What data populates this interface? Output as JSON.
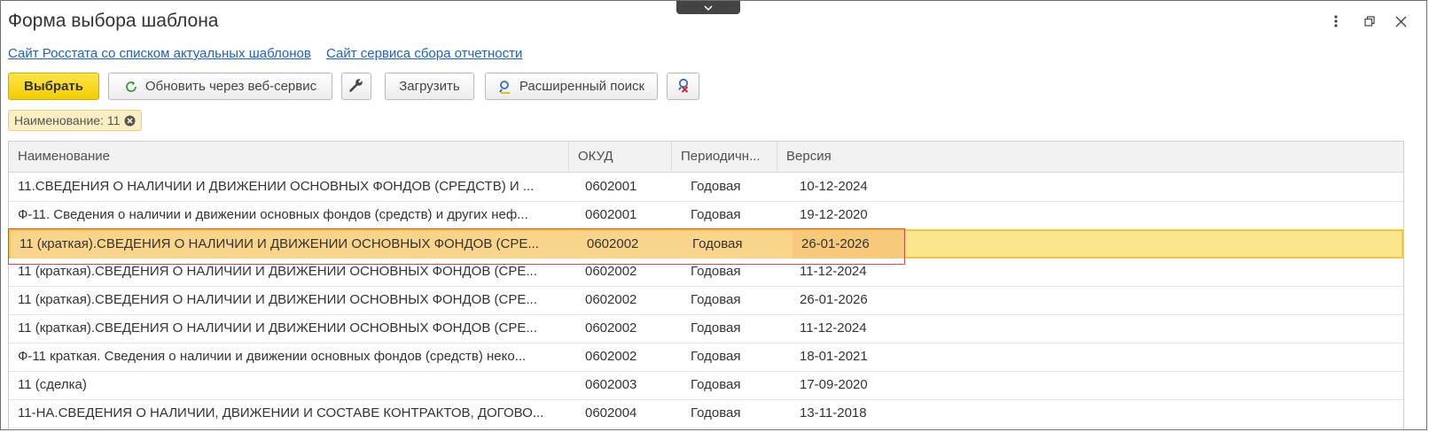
{
  "window": {
    "title": "Форма выбора шаблона"
  },
  "links": [
    "Сайт Росстата со списком актуальных шаблонов",
    "Сайт сервиса сбора отчетности"
  ],
  "toolbar": {
    "select_label": "Выбрать",
    "refresh_label": "Обновить через веб-сервис",
    "load_label": "Загрузить",
    "advanced_search_label": "Расширенный поиск"
  },
  "filter": {
    "label": "Наименование: 11"
  },
  "table": {
    "columns": [
      "Наименование",
      "ОКУД",
      "Периодичн...",
      "Версия"
    ],
    "selected_row": 2,
    "rows": [
      {
        "name": "11.СВЕДЕНИЯ О НАЛИЧИИ И ДВИЖЕНИИ ОСНОВНЫХ ФОНДОВ (СРЕДСТВ) И ...",
        "okud": "0602001",
        "period": "Годовая",
        "version": "10-12-2024"
      },
      {
        "name": "Ф-11. Сведения о наличии и движении основных фондов (средств) и других неф...",
        "okud": "0602001",
        "period": "Годовая",
        "version": "19-12-2020"
      },
      {
        "name": "11 (краткая).СВЕДЕНИЯ О НАЛИЧИИ И ДВИЖЕНИИ ОСНОВНЫХ ФОНДОВ (СРЕ...",
        "okud": "0602002",
        "period": "Годовая",
        "version": "26-01-2026"
      },
      {
        "name": "11 (краткая).СВЕДЕНИЯ О НАЛИЧИИ И ДВИЖЕНИИ ОСНОВНЫХ ФОНДОВ (СРЕ...",
        "okud": "0602002",
        "period": "Годовая",
        "version": "11-12-2024"
      },
      {
        "name": "11 (краткая).СВЕДЕНИЯ О НАЛИЧИИ И ДВИЖЕНИИ ОСНОВНЫХ ФОНДОВ (СРЕ...",
        "okud": "0602002",
        "period": "Годовая",
        "version": "26-01-2026"
      },
      {
        "name": "11 (краткая).СВЕДЕНИЯ О НАЛИЧИИ И ДВИЖЕНИИ ОСНОВНЫХ ФОНДОВ (СРЕ...",
        "okud": "0602002",
        "period": "Годовая",
        "version": "11-12-2024"
      },
      {
        "name": "Ф-11 краткая. Сведения о наличии и движении основных фондов (средств) неко...",
        "okud": "0602002",
        "period": "Годовая",
        "version": "18-01-2021"
      },
      {
        "name": "11 (сделка)",
        "okud": "0602003",
        "period": "Годовая",
        "version": "17-09-2020"
      },
      {
        "name": "11-НА.СВЕДЕНИЯ О НАЛИЧИИ, ДВИЖЕНИИ И СОСТАВЕ КОНТРАКТОВ, ДОГОВО...",
        "okud": "0602004",
        "period": "Годовая",
        "version": "13-11-2018"
      }
    ]
  },
  "icons": {
    "refresh": "refresh-icon",
    "settings": "wrench-icon",
    "search": "search-icon",
    "clear_search": "clear-search-icon",
    "clear_filter": "clear-filter-icon"
  },
  "colors": {
    "primary_button": "#f2cd00",
    "link": "#1a62c5",
    "selected_row": "#fbe68e",
    "highlight_outline": "#e0454a"
  }
}
